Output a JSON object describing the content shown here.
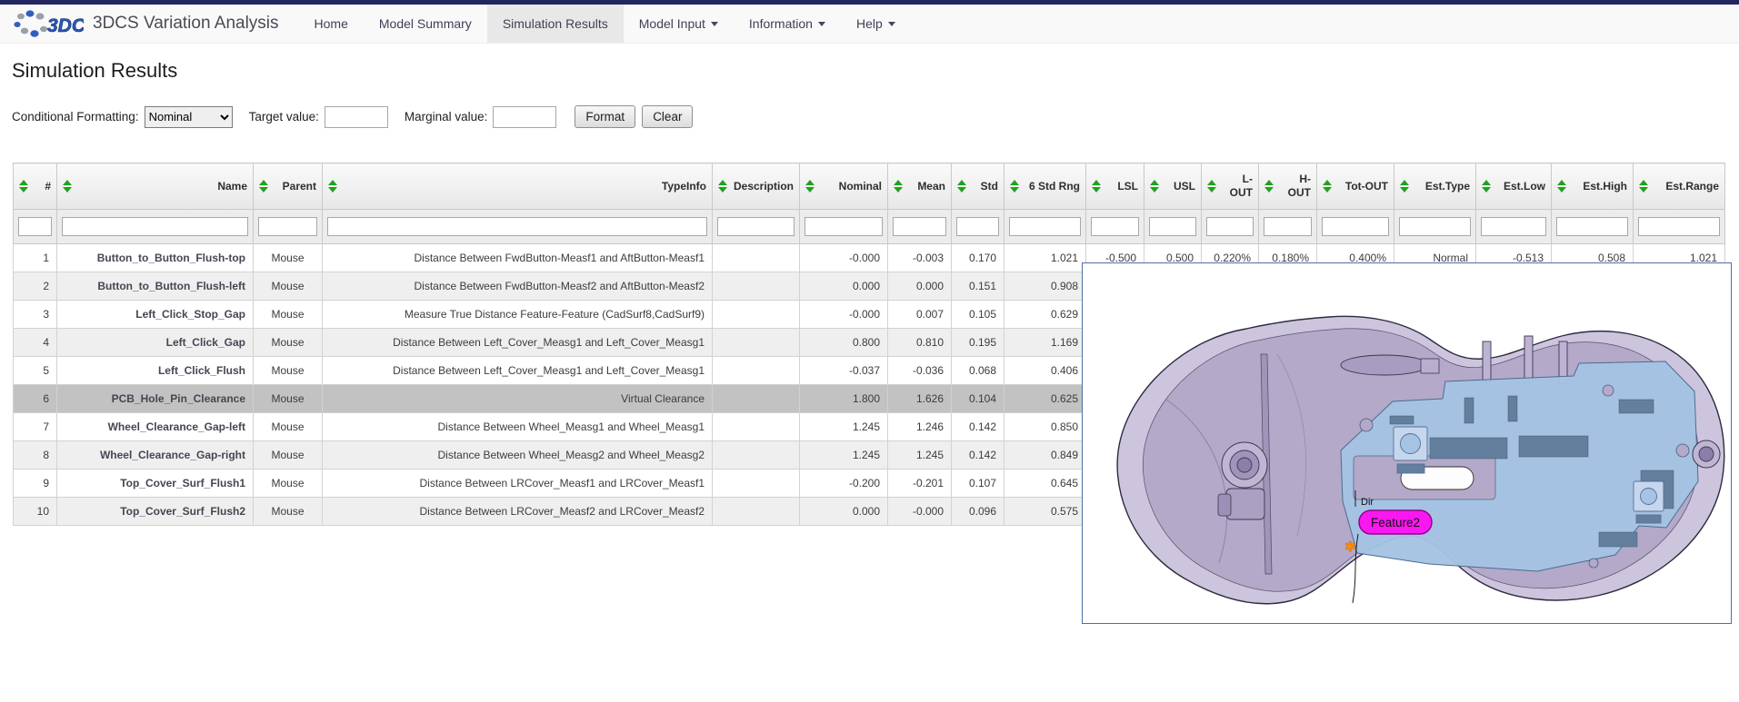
{
  "nav": {
    "brand": "3DCS Variation Analysis",
    "items": [
      {
        "label": "Home",
        "active": false,
        "dropdown": false
      },
      {
        "label": "Model Summary",
        "active": false,
        "dropdown": false
      },
      {
        "label": "Simulation Results",
        "active": true,
        "dropdown": false
      },
      {
        "label": "Model Input",
        "active": false,
        "dropdown": true
      },
      {
        "label": "Information",
        "active": false,
        "dropdown": true
      },
      {
        "label": "Help",
        "active": false,
        "dropdown": true
      }
    ]
  },
  "page": {
    "title": "Simulation Results"
  },
  "controls": {
    "conditional_formatting_label": "Conditional Formatting:",
    "conditional_formatting_value": "Nominal",
    "target_label": "Target value:",
    "target_value": "",
    "marginal_label": "Marginal value:",
    "marginal_value": "",
    "format_button": "Format",
    "clear_button": "Clear"
  },
  "table": {
    "columns": [
      {
        "label": "#",
        "field": "num"
      },
      {
        "label": "Name",
        "field": "name"
      },
      {
        "label": "Parent",
        "field": "parent"
      },
      {
        "label": "TypeInfo",
        "field": "typeinfo"
      },
      {
        "label": "Description",
        "field": "description"
      },
      {
        "label": "Nominal",
        "field": "nominal"
      },
      {
        "label": "Mean",
        "field": "mean"
      },
      {
        "label": "Std",
        "field": "std"
      },
      {
        "label": "6 Std Rng",
        "field": "rng6"
      },
      {
        "label": "LSL",
        "field": "lsl"
      },
      {
        "label": "USL",
        "field": "usl"
      },
      {
        "label": "L-OUT",
        "field": "lout"
      },
      {
        "label": "H-OUT",
        "field": "hout"
      },
      {
        "label": "Tot-OUT",
        "field": "totout"
      },
      {
        "label": "Est.Type",
        "field": "esttype"
      },
      {
        "label": "Est.Low",
        "field": "estlow"
      },
      {
        "label": "Est.High",
        "field": "esthigh"
      },
      {
        "label": "Est.Range",
        "field": "estrange"
      }
    ],
    "rows": [
      {
        "num": "1",
        "name": "Button_to_Button_Flush-top",
        "parent": "Mouse",
        "typeinfo": "Distance Between FwdButton-Measf1 and AftButton-Measf1",
        "description": "",
        "nominal": "-0.000",
        "mean": "-0.003",
        "std": "0.170",
        "rng6": "1.021",
        "lsl": "-0.500",
        "usl": "0.500",
        "lout": "0.220%",
        "hout": "0.180%",
        "totout": "0.400%",
        "esttype": "Normal",
        "estlow": "-0.513",
        "esthigh": "0.508",
        "estrange": "1.021",
        "selected": false
      },
      {
        "num": "2",
        "name": "Button_to_Button_Flush-left",
        "parent": "Mouse",
        "typeinfo": "Distance Between FwdButton-Measf2 and AftButton-Measf2",
        "description": "",
        "nominal": "0.000",
        "mean": "0.000",
        "std": "0.151",
        "rng6": "0.908",
        "lsl": "",
        "usl": "",
        "lout": "",
        "hout": "",
        "totout": "",
        "esttype": "",
        "estlow": "",
        "esthigh": "",
        "estrange": "",
        "selected": false
      },
      {
        "num": "3",
        "name": "Left_Click_Stop_Gap",
        "parent": "Mouse",
        "typeinfo": "Measure True Distance Feature-Feature (CadSurf8,CadSurf9)",
        "description": "",
        "nominal": "-0.000",
        "mean": "0.007",
        "std": "0.105",
        "rng6": "0.629",
        "lsl": "",
        "usl": "",
        "lout": "",
        "hout": "",
        "totout": "",
        "esttype": "",
        "estlow": "",
        "esthigh": "",
        "estrange": "",
        "selected": false
      },
      {
        "num": "4",
        "name": "Left_Click_Gap",
        "parent": "Mouse",
        "typeinfo": "Distance Between Left_Cover_Measg1 and Left_Cover_Measg1",
        "description": "",
        "nominal": "0.800",
        "mean": "0.810",
        "std": "0.195",
        "rng6": "1.169",
        "lsl": "",
        "usl": "",
        "lout": "",
        "hout": "",
        "totout": "",
        "esttype": "",
        "estlow": "",
        "esthigh": "",
        "estrange": "",
        "selected": false
      },
      {
        "num": "5",
        "name": "Left_Click_Flush",
        "parent": "Mouse",
        "typeinfo": "Distance Between Left_Cover_Measg1 and Left_Cover_Measg1",
        "description": "",
        "nominal": "-0.037",
        "mean": "-0.036",
        "std": "0.068",
        "rng6": "0.406",
        "lsl": "",
        "usl": "",
        "lout": "",
        "hout": "",
        "totout": "",
        "esttype": "",
        "estlow": "",
        "esthigh": "",
        "estrange": "",
        "selected": false
      },
      {
        "num": "6",
        "name": "PCB_Hole_Pin_Clearance",
        "parent": "Mouse",
        "typeinfo": "Virtual Clearance",
        "description": "",
        "nominal": "1.800",
        "mean": "1.626",
        "std": "0.104",
        "rng6": "0.625",
        "lsl": "",
        "usl": "",
        "lout": "",
        "hout": "",
        "totout": "",
        "esttype": "",
        "estlow": "",
        "esthigh": "",
        "estrange": "",
        "selected": true
      },
      {
        "num": "7",
        "name": "Wheel_Clearance_Gap-left",
        "parent": "Mouse",
        "typeinfo": "Distance Between Wheel_Measg1 and Wheel_Measg1",
        "description": "",
        "nominal": "1.245",
        "mean": "1.246",
        "std": "0.142",
        "rng6": "0.850",
        "lsl": "",
        "usl": "",
        "lout": "",
        "hout": "",
        "totout": "",
        "esttype": "",
        "estlow": "",
        "esthigh": "",
        "estrange": "",
        "selected": false
      },
      {
        "num": "8",
        "name": "Wheel_Clearance_Gap-right",
        "parent": "Mouse",
        "typeinfo": "Distance Between Wheel_Measg2 and Wheel_Measg2",
        "description": "",
        "nominal": "1.245",
        "mean": "1.245",
        "std": "0.142",
        "rng6": "0.849",
        "lsl": "",
        "usl": "",
        "lout": "",
        "hout": "",
        "totout": "",
        "esttype": "",
        "estlow": "",
        "esthigh": "",
        "estrange": "",
        "selected": false
      },
      {
        "num": "9",
        "name": "Top_Cover_Surf_Flush1",
        "parent": "Mouse",
        "typeinfo": "Distance Between LRCover_Measf1 and LRCover_Measf1",
        "description": "",
        "nominal": "-0.200",
        "mean": "-0.201",
        "std": "0.107",
        "rng6": "0.645",
        "lsl": "",
        "usl": "",
        "lout": "",
        "hout": "",
        "totout": "",
        "esttype": "",
        "estlow": "",
        "esthigh": "",
        "estrange": "",
        "selected": false
      },
      {
        "num": "10",
        "name": "Top_Cover_Surf_Flush2",
        "parent": "Mouse",
        "typeinfo": "Distance Between LRCover_Measf2 and LRCover_Measf2",
        "description": "",
        "nominal": "0.000",
        "mean": "-0.000",
        "std": "0.096",
        "rng6": "0.575",
        "lsl": "",
        "usl": "",
        "lout": "",
        "hout": "",
        "totout": "",
        "esttype": "",
        "estlow": "",
        "esthigh": "",
        "estrange": "",
        "selected": false
      }
    ]
  },
  "viewer": {
    "feature_label": "Feature2",
    "dir_label": "Dir"
  },
  "colors": {
    "nav_top_bar": "#23265e",
    "active_tab_bg": "#e8e8e8",
    "sort_arrow_green": "#1fa21f",
    "selected_row_bg": "#c2c2c2",
    "viewer_border_blue": "#4c70a3",
    "shell_lavender": "#b4a9c8",
    "pcb_blue": "#a6c3e3",
    "feature_label_magenta": "#fa18f0"
  }
}
